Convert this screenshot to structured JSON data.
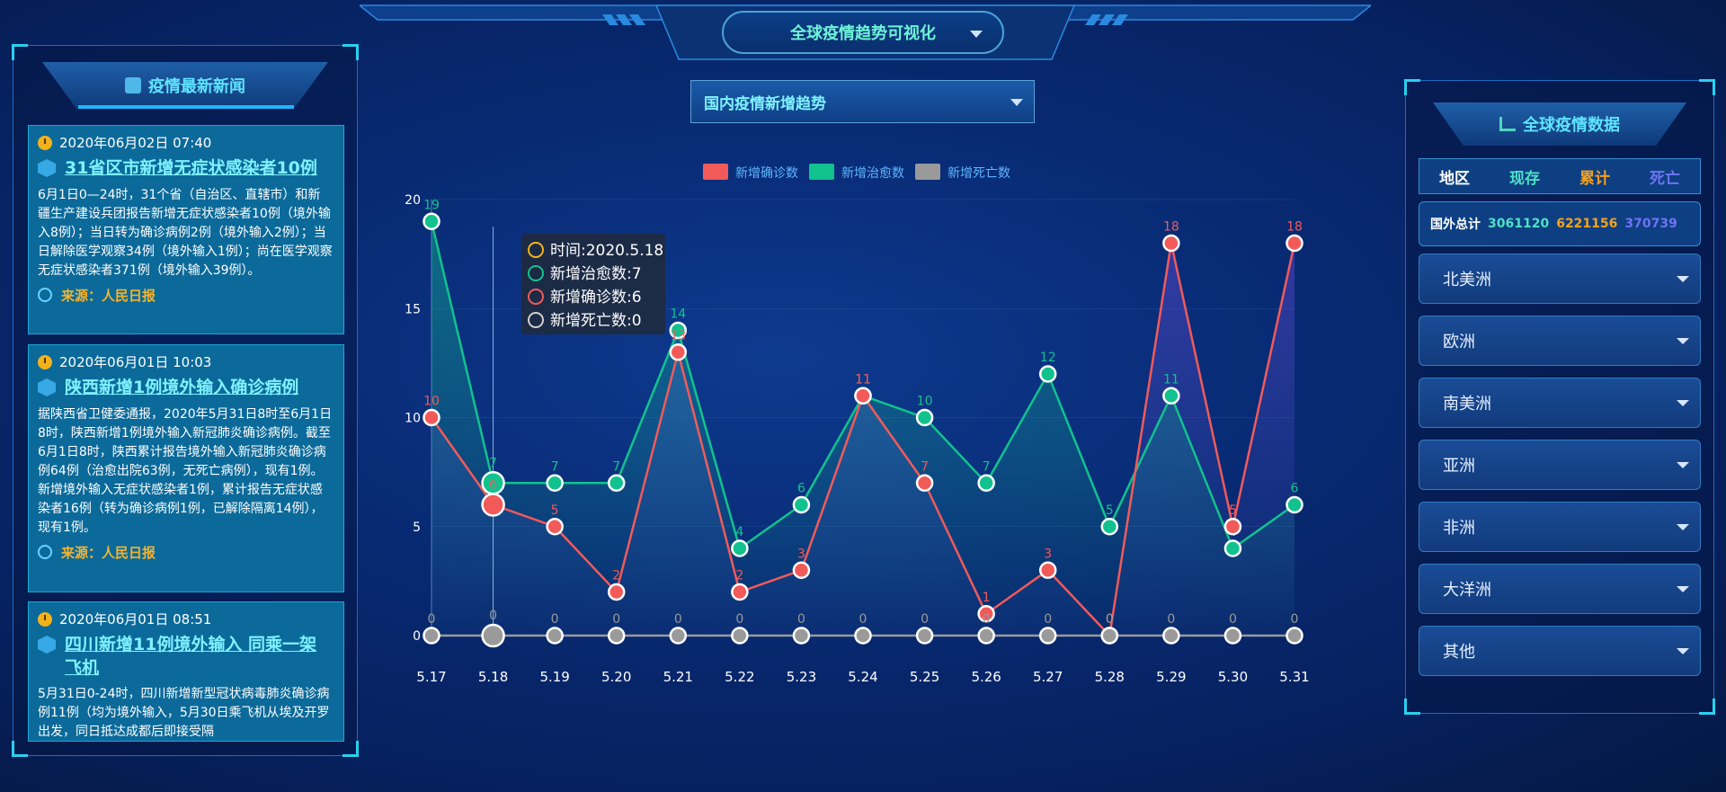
{
  "header": {
    "title": "全球疫情趋势可视化"
  },
  "news_panel": {
    "title": "疫情最新新闻",
    "items": [
      {
        "date": "2020年06月02日 07:40",
        "title": "31省区市新增无症状感染者10例",
        "body": "6月1日0—24时，31个省（自治区、直辖市）和新疆生产建设兵团报告新增无症状感染者10例（境外输入8例）；当日转为确诊病例2例（境外输入2例）；当日解除医学观察34例（境外输入1例）；尚在医学观察无症状感染者371例（境外输入39例）。",
        "source": "来源：人民日报"
      },
      {
        "date": "2020年06月01日 10:03",
        "title": "陕西新增1例境外输入确诊病例",
        "body": "据陕西省卫健委通报，2020年5月31日8时至6月1日8时，陕西新增1例境外输入新冠肺炎确诊病例。截至6月1日8时，陕西累计报告境外输入新冠肺炎确诊病例64例（治愈出院63例，无死亡病例），现有1例。新增境外输入无症状感染者1例，累计报告无症状感染者16例（转为确诊病例1例，已解除隔离14例），现有1例。",
        "source": "来源：人民日报"
      },
      {
        "date": "2020年06月01日 08:51",
        "title": "四川新增11例境外输入 同乘一架飞机",
        "body": "5月31日0-24时，四川新增新型冠状病毒肺炎确诊病例11例（均为境外输入，5月30日乘飞机从埃及开罗出发，同日抵达成都后即接受隔",
        "source": ""
      }
    ]
  },
  "chart_select": {
    "label": "国内疫情新增趋势"
  },
  "chart_data": {
    "type": "line",
    "x": [
      "5.17",
      "5.18",
      "5.19",
      "5.20",
      "5.21",
      "5.22",
      "5.23",
      "5.24",
      "5.25",
      "5.26",
      "5.27",
      "5.28",
      "5.29",
      "5.30",
      "5.31"
    ],
    "series": [
      {
        "name": "新增确诊数",
        "color": "#f25a5a",
        "values": [
          10,
          6,
          5,
          2,
          13,
          2,
          3,
          11,
          7,
          1,
          3,
          0,
          18,
          5,
          18
        ]
      },
      {
        "name": "新增治愈数",
        "color": "#11c28e",
        "values": [
          19,
          7,
          7,
          7,
          14,
          4,
          6,
          11,
          10,
          7,
          12,
          5,
          11,
          4,
          6
        ]
      },
      {
        "name": "新增死亡数",
        "color": "#9a9a9a",
        "values": [
          0,
          0,
          0,
          0,
          0,
          0,
          0,
          0,
          0,
          0,
          0,
          0,
          0,
          0,
          0
        ]
      }
    ],
    "ylim": [
      0,
      20
    ],
    "yticks": [
      0,
      5,
      10,
      15,
      20
    ],
    "legend": "top-center",
    "tooltip": {
      "time": "时间:2020.5.18",
      "cured": "新增治愈数:7",
      "confirmed": "新增确诊数:6",
      "death": "新增死亡数:0",
      "index": 1
    }
  },
  "global_panel": {
    "title": "全球疫情数据",
    "tabs": [
      {
        "label": "地区",
        "color": "#ffffff"
      },
      {
        "label": "现存",
        "color": "#4fe0c8"
      },
      {
        "label": "累计",
        "color": "#f7a21b"
      },
      {
        "label": "死亡",
        "color": "#6f73f5"
      }
    ],
    "total": {
      "label": "国外总计",
      "existing": "3061120",
      "cumulative": "6221156",
      "deaths": "370739"
    },
    "regions": [
      "北美洲",
      "欧洲",
      "南美洲",
      "亚洲",
      "非洲",
      "大洋洲",
      "其他"
    ]
  }
}
